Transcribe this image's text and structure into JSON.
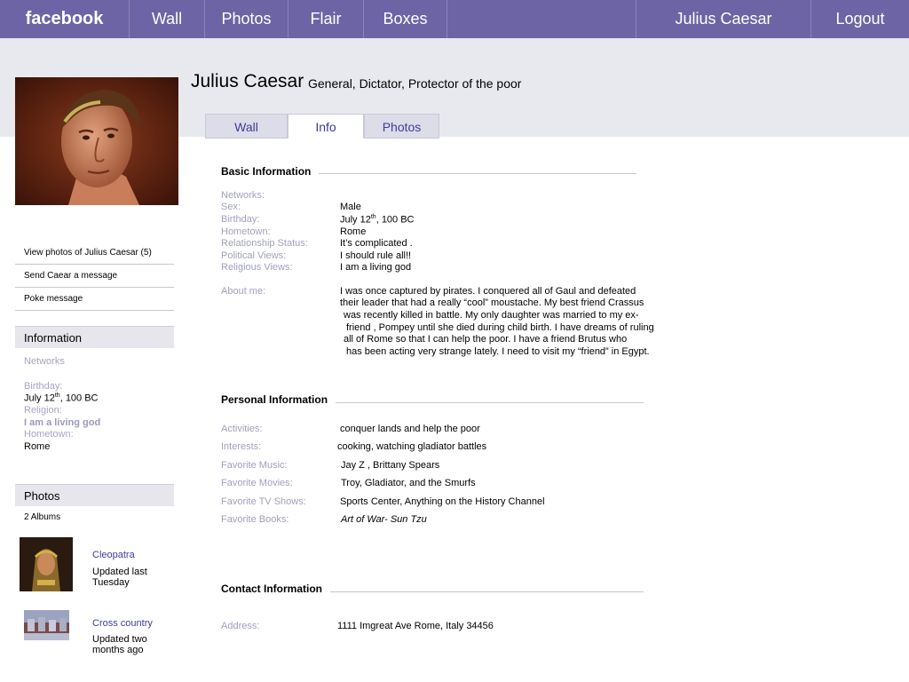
{
  "nav": {
    "logo": "facebook",
    "items": [
      "Wall",
      "Photos",
      "Flair",
      "Boxes"
    ],
    "user": "Julius Caesar",
    "logout": "Logout"
  },
  "profile": {
    "name": "Julius Caesar",
    "tagline": "General, Dictator, Protector of the poor"
  },
  "tabs": [
    "Wall",
    "Info",
    "Photos"
  ],
  "sidebar": {
    "links": [
      "View photos of Julius Caesar (5)",
      "Send Caear a message",
      "Poke message"
    ],
    "info": {
      "title": "Information",
      "networks_label": "Networks",
      "birthday_label": "Birthday:",
      "birthday_value": {
        "day": "July 12",
        "suffix": "th",
        "rest": ", 100 BC"
      },
      "religion_label": "Religion:",
      "religion_value": "I am a living god",
      "hometown_label": "Hometown:",
      "hometown_value": "Rome"
    },
    "photos": {
      "title": "Photos",
      "count": "2 Albums",
      "albums": [
        {
          "name": "Cleopatra",
          "updated": "Updated last Tuesday"
        },
        {
          "name": "Cross country",
          "updated": "Updated two months ago"
        }
      ]
    }
  },
  "basic": {
    "title": "Basic Information",
    "rows": [
      {
        "label": "Networks:",
        "value": ""
      },
      {
        "label": "Sex:",
        "value": "Male"
      },
      {
        "label": "Birthday:",
        "value": "July 12"
      },
      {
        "label": "Hometown:",
        "value": "Rome"
      },
      {
        "label": "Relationship Status:",
        "value": "It’s complicated ."
      },
      {
        "label": "Political Views:",
        "value": "I should rule all!!"
      },
      {
        "label": "Religious Views:",
        "value": "I am a living god"
      }
    ],
    "birthday_suffix": "th",
    "birthday_rest": ", 100 BC",
    "about_label": "About me:",
    "about_lines": [
      "I  was once captured by pirates.  I conquered  all of Gaul and defeated",
      "their leader that had a really “cool” moustache.  My best friend Crassus",
      "was recently killed in battle.  My only daughter was married to my ex-",
      "friend , Pompey  until she died during child birth.  I have dreams of ruling",
      "all of Rome so that I can help the poor.  I have  a friend Brutus who",
      "has been acting very strange lately.  I need to visit my “friend” in Egypt."
    ]
  },
  "personal": {
    "title": "Personal Information",
    "rows": [
      {
        "label": "Activities:",
        "value": "conquer lands and help the poor"
      },
      {
        "label": "Interests:",
        "value": "cooking,  watching gladiator battles"
      },
      {
        "label": "Favorite Music:",
        "value": "Jay Z , Brittany Spears"
      },
      {
        "label": "Favorite Movies:",
        "value": "Troy,  Gladiator, and  the Smurfs"
      },
      {
        "label": "Favorite TV Shows:",
        "value": "Sports Center,  Anything on the History Channel"
      },
      {
        "label": "Favorite Books:",
        "value": "Art of War- Sun Tzu"
      }
    ]
  },
  "contact": {
    "title": "Contact Information",
    "address_label": "Address:",
    "address_value": "1111   Imgreat  Ave   Rome, Italy   34456"
  },
  "colors": {
    "nav_bg": "#6c64a4",
    "link": "#3b3b9b",
    "label": "#a0a0bc"
  }
}
